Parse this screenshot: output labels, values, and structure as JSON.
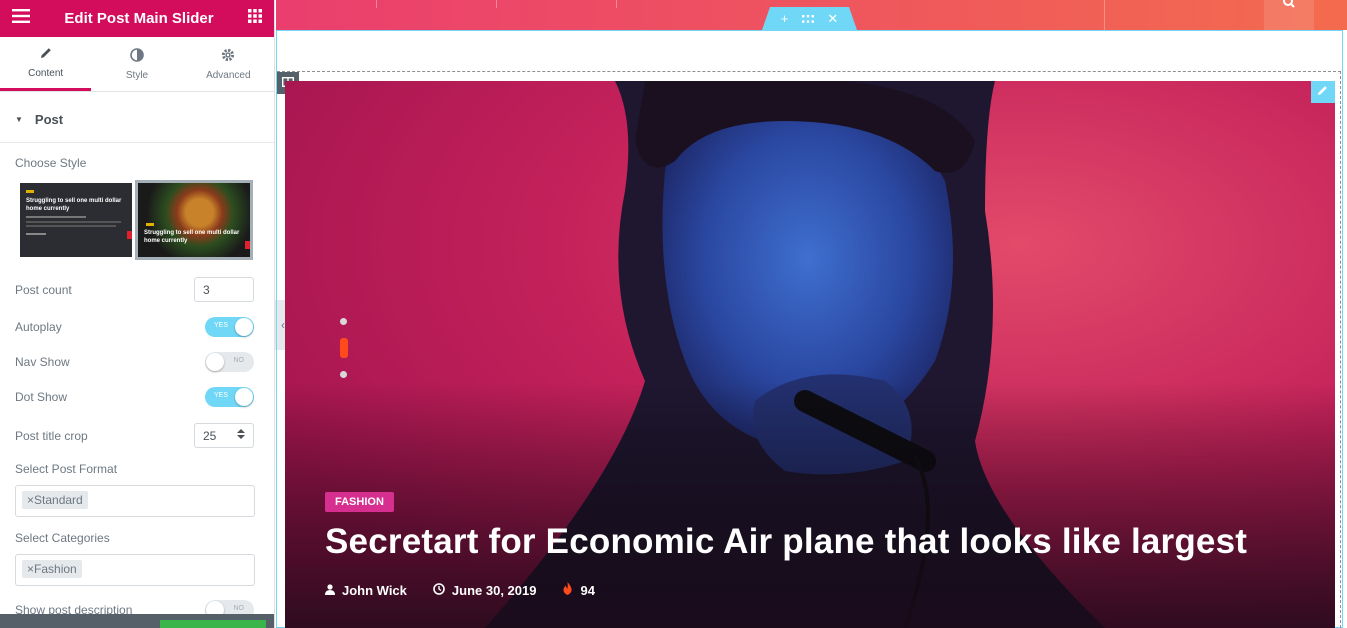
{
  "panel": {
    "title": "Edit Post Main Slider",
    "tabs": [
      {
        "label": "Content"
      },
      {
        "label": "Style"
      },
      {
        "label": "Advanced"
      }
    ],
    "section": "Post",
    "choose_style_label": "Choose Style",
    "style_thumb_caption": "Struggling to sell one multi dollar home currently",
    "controls": {
      "post_count": {
        "label": "Post count",
        "value": "3"
      },
      "autoplay": {
        "label": "Autoplay",
        "state": "YES"
      },
      "nav_show": {
        "label": "Nav Show",
        "state": "NO"
      },
      "dot_show": {
        "label": "Dot Show",
        "state": "YES"
      },
      "title_crop": {
        "label": "Post title crop",
        "value": "25"
      },
      "post_format": {
        "label": "Select Post Format",
        "tag": "Standard"
      },
      "categories": {
        "label": "Select Categories",
        "tag": "Fashion"
      },
      "show_desc": {
        "label": "Show post description",
        "state": "NO"
      }
    }
  },
  "slider": {
    "category": "FASHION",
    "title": "Secretart for Economic Air plane that looks like largest",
    "author": "John Wick",
    "date": "June 30, 2019",
    "views": "94"
  },
  "colors": {
    "brand": "#d30c5c",
    "accent": "#71d7f7",
    "badge": "#d62f8f",
    "dot_active": "#ff4a1c"
  }
}
